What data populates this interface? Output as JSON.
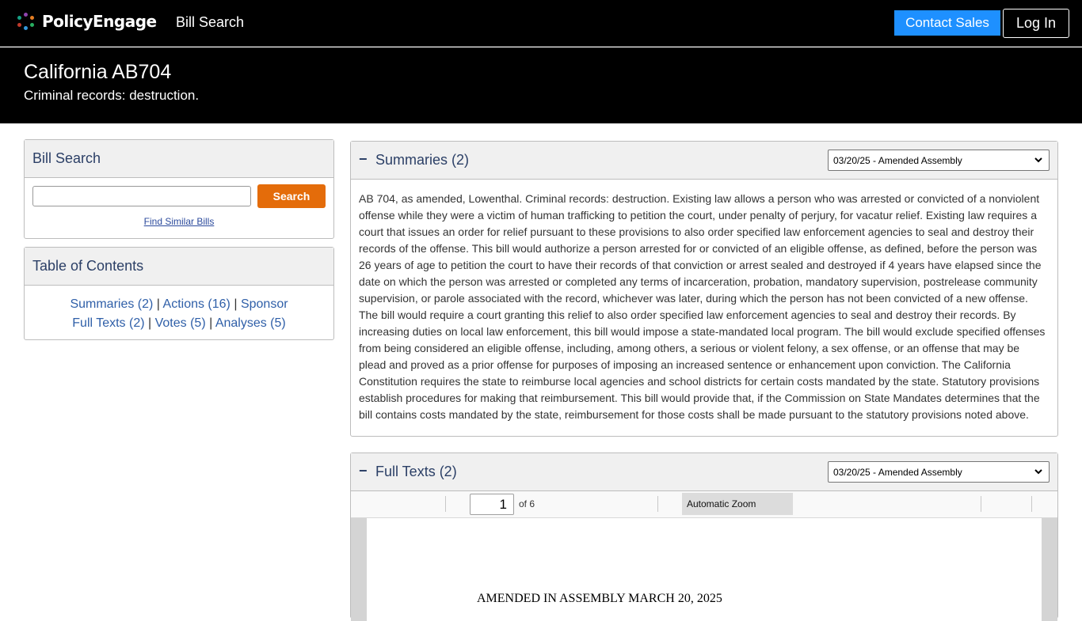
{
  "brand": {
    "name": "PolicyEngage",
    "dot_colors": [
      "#8e44ad",
      "#e67e22",
      "#27ae60",
      "#3498db",
      "#c0392b",
      "#16a085"
    ]
  },
  "nav": {
    "bill_search": "Bill Search",
    "contact_sales": "Contact Sales",
    "login": "Log In"
  },
  "bill": {
    "title": "California AB704",
    "subtitle": "Criminal records: destruction."
  },
  "search_panel": {
    "title": "Bill Search",
    "search_value": "",
    "search_button": "Search",
    "similar_link": "Find Similar Bills"
  },
  "toc": {
    "title": "Table of Contents",
    "links": {
      "summaries": "Summaries (2)",
      "actions": "Actions (16)",
      "sponsor": "Sponsor",
      "full_texts": "Full Texts (2)",
      "votes": "Votes (5)",
      "analyses": "Analyses (5)"
    }
  },
  "summaries": {
    "collapse_symbol": "−",
    "title": "Summaries (2)",
    "selected_version": "03/20/25 - Amended Assembly",
    "text": "AB 704, as amended, Lowenthal. Criminal records: destruction. Existing law allows a person who was arrested or convicted of a nonviolent offense while they were a victim of human trafficking to petition the court, under penalty of perjury, for vacatur relief. Existing law requires a court that issues an order for relief pursuant to these provisions to also order specified law enforcement agencies to seal and destroy their records of the offense. This bill would authorize a person arrested for or convicted of an eligible offense, as defined, before the person was 26 years of age to petition the court to have their records of that conviction or arrest sealed and destroyed if 4 years have elapsed since the date on which the person was arrested or completed any terms of incarceration, probation, mandatory supervision, postrelease community supervision, or parole associated with the record, whichever was later, during which the person has not been convicted of a new offense. The bill would require a court granting this relief to also order specified law enforcement agencies to seal and destroy their records. By increasing duties on local law enforcement, this bill would impose a state-mandated local program. The bill would exclude specified offenses from being considered an eligible offense, including, among others, a serious or violent felony, a sex offense, or an offense that may be plead and proved as a prior offense for purposes of imposing an increased sentence or enhancement upon conviction. The California Constitution requires the state to reimburse local agencies and school districts for certain costs mandated by the state. Statutory provisions establish procedures for making that reimbursement. This bill would provide that, if the Commission on State Mandates determines that the bill contains costs mandated by the state, reimbursement for those costs shall be made pursuant to the statutory provisions noted above."
  },
  "full_texts": {
    "collapse_symbol": "−",
    "title": "Full Texts (2)",
    "selected_version": "03/20/25 - Amended Assembly",
    "pdf": {
      "page_number": "1",
      "page_count": "of 6",
      "zoom": "Automatic Zoom",
      "page_heading": "AMENDED IN ASSEMBLY MARCH 20, 2025"
    }
  }
}
